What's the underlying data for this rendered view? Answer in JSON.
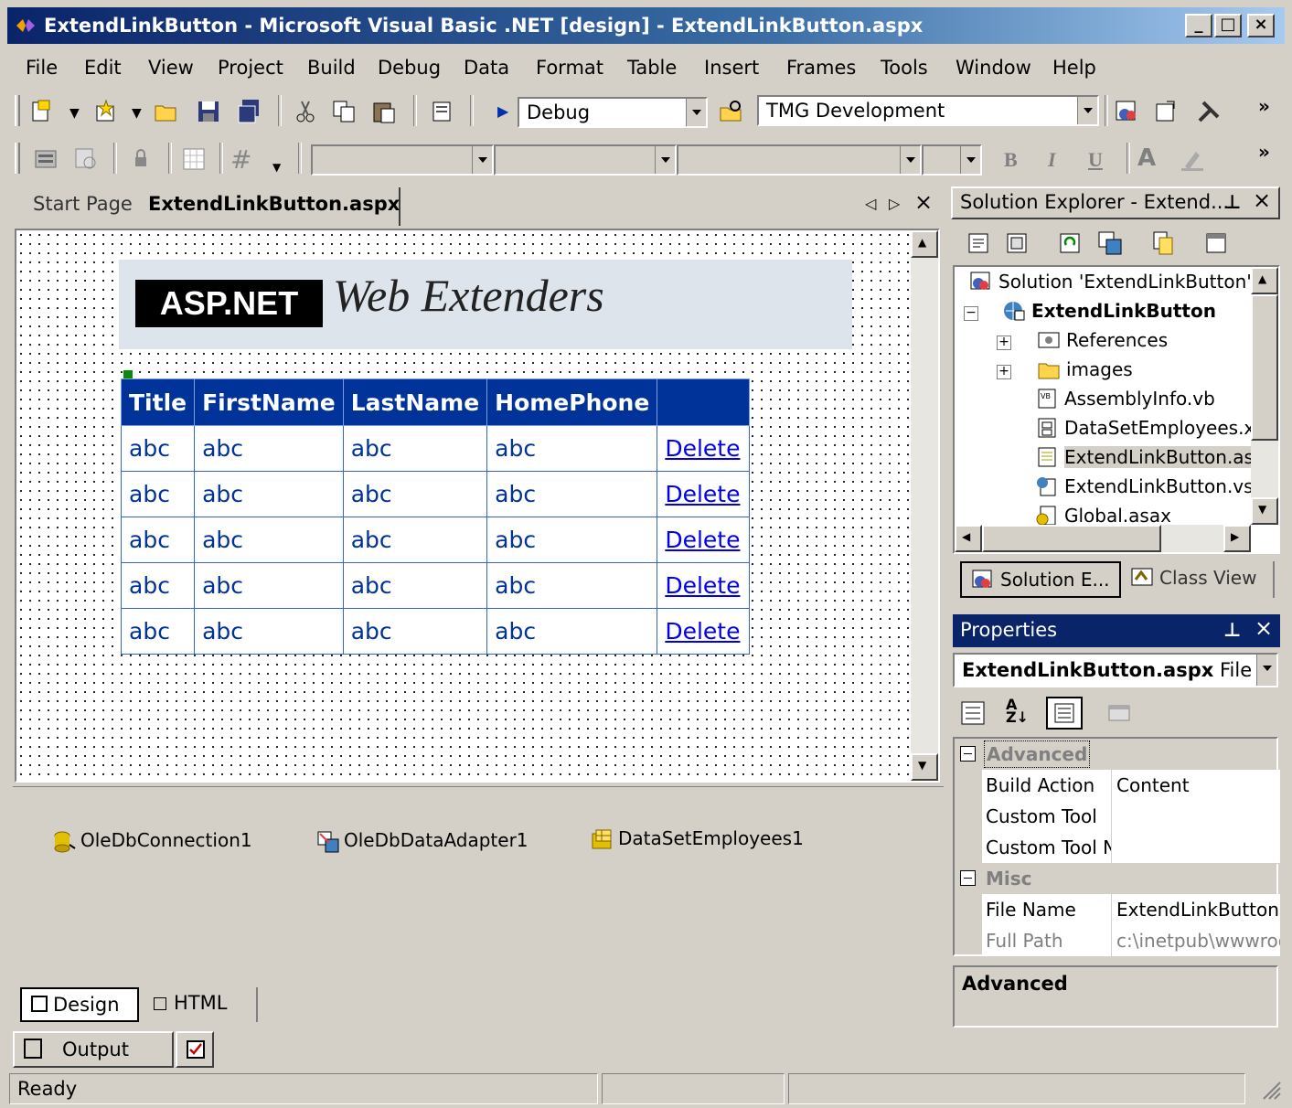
{
  "window": {
    "title": "ExtendLinkButton - Microsoft Visual Basic .NET [design] - ExtendLinkButton.aspx"
  },
  "menu": [
    "File",
    "Edit",
    "View",
    "Project",
    "Build",
    "Debug",
    "Data",
    "Format",
    "Table",
    "Insert",
    "Frames",
    "Tools",
    "Window",
    "Help"
  ],
  "toolbar": {
    "configuration": "Debug",
    "startup_target": "TMG Development"
  },
  "format_toolbar": {
    "bold": "B",
    "italic": "I",
    "underline": "U"
  },
  "doc_tabs": [
    {
      "label": "Start Page",
      "active": false
    },
    {
      "label": "ExtendLinkButton.aspx",
      "active": true
    }
  ],
  "banner": {
    "logo_text": "ASP.NET",
    "tagline": "Web Extenders"
  },
  "grid": {
    "headers": [
      "Title",
      "FirstName",
      "LastName",
      "HomePhone",
      ""
    ],
    "rows": [
      [
        "abc",
        "abc",
        "abc",
        "abc",
        "Delete"
      ],
      [
        "abc",
        "abc",
        "abc",
        "abc",
        "Delete"
      ],
      [
        "abc",
        "abc",
        "abc",
        "abc",
        "Delete"
      ],
      [
        "abc",
        "abc",
        "abc",
        "abc",
        "Delete"
      ],
      [
        "abc",
        "abc",
        "abc",
        "abc",
        "Delete"
      ]
    ]
  },
  "components": [
    "OleDbConnection1",
    "OleDbDataAdapter1",
    "DataSetEmployees1"
  ],
  "view_tabs": {
    "design": "Design",
    "html": "HTML"
  },
  "output_tab": "Output",
  "status": {
    "text": "Ready"
  },
  "solution_explorer": {
    "title": "Solution Explorer - Extend...",
    "tree": [
      "Solution 'ExtendLinkButton' (",
      "ExtendLinkButton",
      "References",
      "images",
      "AssemblyInfo.vb",
      "DataSetEmployees.x",
      "ExtendLinkButton.as",
      "ExtendLinkButton.vs",
      "Global.asax"
    ],
    "bottom_tabs": [
      "Solution E...",
      "Class View"
    ]
  },
  "properties": {
    "title": "Properties",
    "object": "ExtendLinkButton.aspx",
    "object_type": "File",
    "categories": [
      {
        "name": "Advanced",
        "rows": [
          {
            "key": "Build Action",
            "value": "Content"
          },
          {
            "key": "Custom Tool",
            "value": ""
          },
          {
            "key": "Custom Tool N",
            "value": ""
          }
        ]
      },
      {
        "name": "Misc",
        "rows": [
          {
            "key": "File Name",
            "value": "ExtendLinkButton.a"
          },
          {
            "key": "Full Path",
            "value": "c:\\inetpub\\wwwroo"
          }
        ]
      }
    ],
    "description_title": "Advanced"
  }
}
